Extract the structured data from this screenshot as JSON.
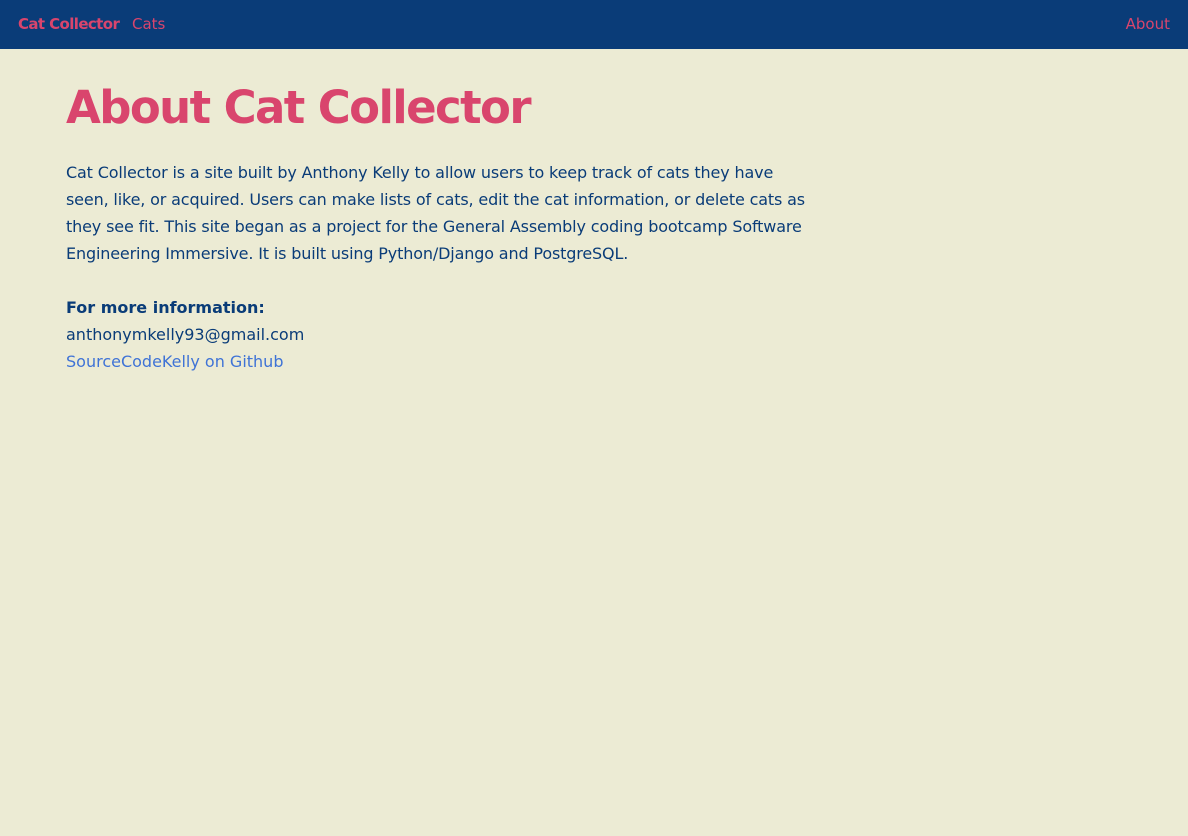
{
  "nav": {
    "brand": "Cat Collector",
    "cats": "Cats",
    "about": "About"
  },
  "main": {
    "title": "About Cat Collector",
    "description": "Cat Collector is a site built by Anthony Kelly to allow users to keep track of cats they have seen, like, or acquired. Users can make lists of cats, edit the cat information, or delete cats as they see fit. This site began as a project for the General Assembly coding bootcamp Software Engineering Immersive. It is built using Python/Django and PostgreSQL.",
    "info_heading": "For more information:",
    "email": "anthonymkelly93@gmail.com",
    "github_link": "SourceCodeKelly on Github"
  },
  "colors": {
    "navbar_bg": "#0a3c78",
    "page_bg": "#ecebd4",
    "accent": "#d9456d",
    "text": "#0a3c78",
    "link": "#3f73d6"
  }
}
